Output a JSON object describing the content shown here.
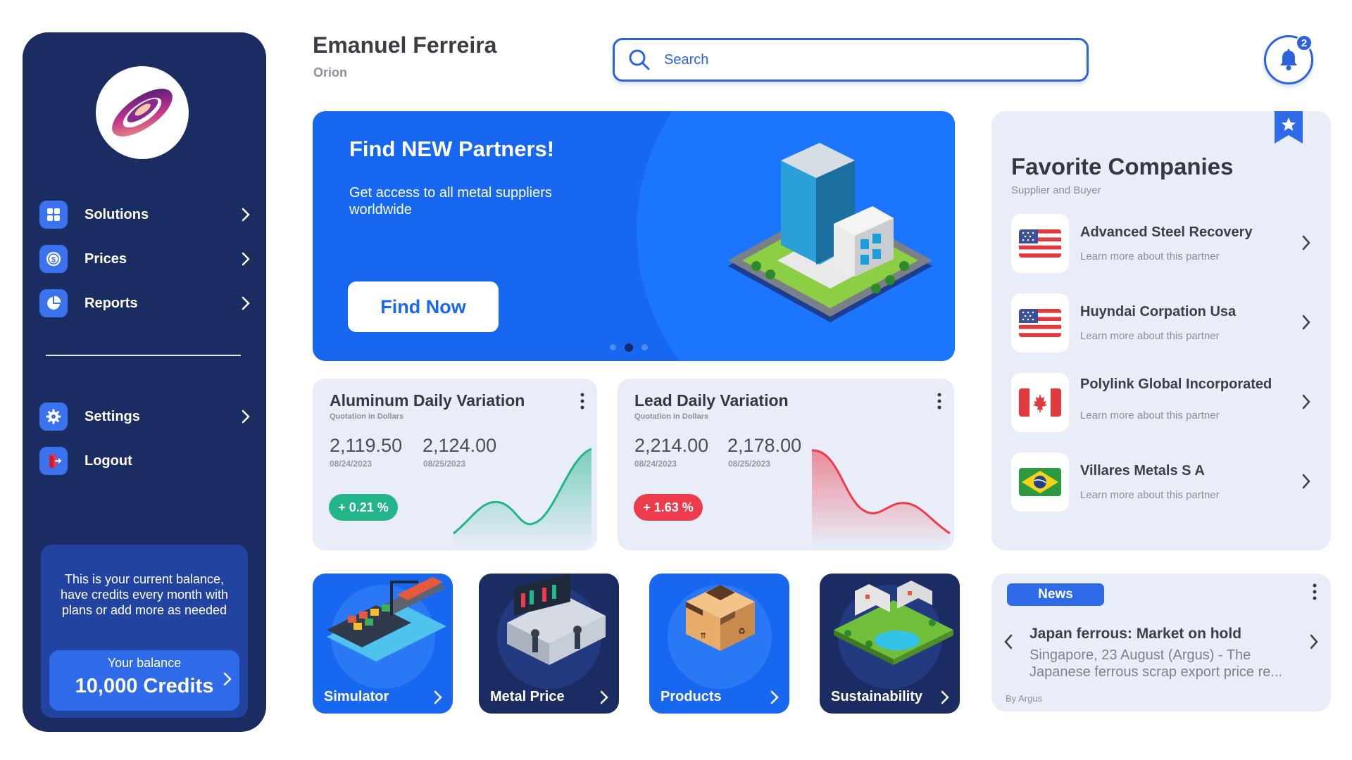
{
  "header": {
    "user_name": "Emanuel Ferreira",
    "organization": "Orion",
    "search_placeholder": "Search",
    "notifications_count": "2"
  },
  "sidebar": {
    "items": [
      {
        "label": "Solutions",
        "icon": "grid-icon"
      },
      {
        "label": "Prices",
        "icon": "dollar-coin-icon"
      },
      {
        "label": "Reports",
        "icon": "pie-chart-icon"
      }
    ],
    "secondary_items": [
      {
        "label": "Settings",
        "icon": "gear-icon"
      },
      {
        "label": "Logout",
        "icon": "logout-icon"
      }
    ],
    "balance": {
      "message": "This is your current balance, have credits every month with plans or add more as needed",
      "label": "Your balance",
      "value": "10,000 Credits"
    }
  },
  "hero": {
    "title_prefix": "Find ",
    "title_highlight": "NEW",
    "title_suffix": " Partners!",
    "subtitle": "Get access to all metal suppliers worldwide",
    "button_label": "Find Now",
    "slides": 3,
    "active_slide": 2
  },
  "variations": [
    {
      "title": "Aluminum Daily Variation",
      "subtitle": "Quotation in Dollars",
      "value1": "2,119.50",
      "date1": "08/24/2023",
      "value2": "2,124.00",
      "date2": "08/25/2023",
      "change": "+ 0.21 %",
      "direction": "up",
      "color": "#23b58a"
    },
    {
      "title": "Lead Daily Variation",
      "subtitle": "Quotation in Dollars",
      "value1": "2,214.00",
      "date1": "08/24/2023",
      "value2": "2,178.00",
      "date2": "08/25/2023",
      "change": "+ 1.63 %",
      "direction": "down",
      "color": "#ee3b4b"
    }
  ],
  "tiles": [
    {
      "label": "Simulator",
      "icon": "cargo-ship-icon"
    },
    {
      "label": "Metal Price",
      "icon": "trading-desk-icon"
    },
    {
      "label": "Products",
      "icon": "package-box-icon"
    },
    {
      "label": "Sustainability",
      "icon": "green-city-icon"
    }
  ],
  "favorites": {
    "title": "Favorite Companies",
    "subtitle": "Supplier and Buyer",
    "companies": [
      {
        "name": "Advanced Steel Recovery",
        "sub": "Learn more about this partner",
        "flag": "usa-flag-icon"
      },
      {
        "name": "Huyndai Corpation Usa",
        "sub": "Learn more about this partner",
        "flag": "usa-flag-icon"
      },
      {
        "name": "Polylink Global Incorporated",
        "sub": "Learn more about this partner",
        "flag": "canada-flag-icon"
      },
      {
        "name": "Villares Metals S A",
        "sub": "Learn more about this partner",
        "flag": "brazil-flag-icon"
      }
    ]
  },
  "news": {
    "badge": "News",
    "title": "Japan ferrous: Market on hold",
    "body": "Singapore, 23 August (Argus) - The Japanese ferrous scrap export price re...",
    "byline": "By Argus"
  },
  "colors": {
    "sidebar": "#1b2c63",
    "primary": "#2c62e0",
    "hero": "#1767f0",
    "card": "#e8edf8",
    "positive": "#23b58a",
    "negative": "#ee3b4b"
  }
}
